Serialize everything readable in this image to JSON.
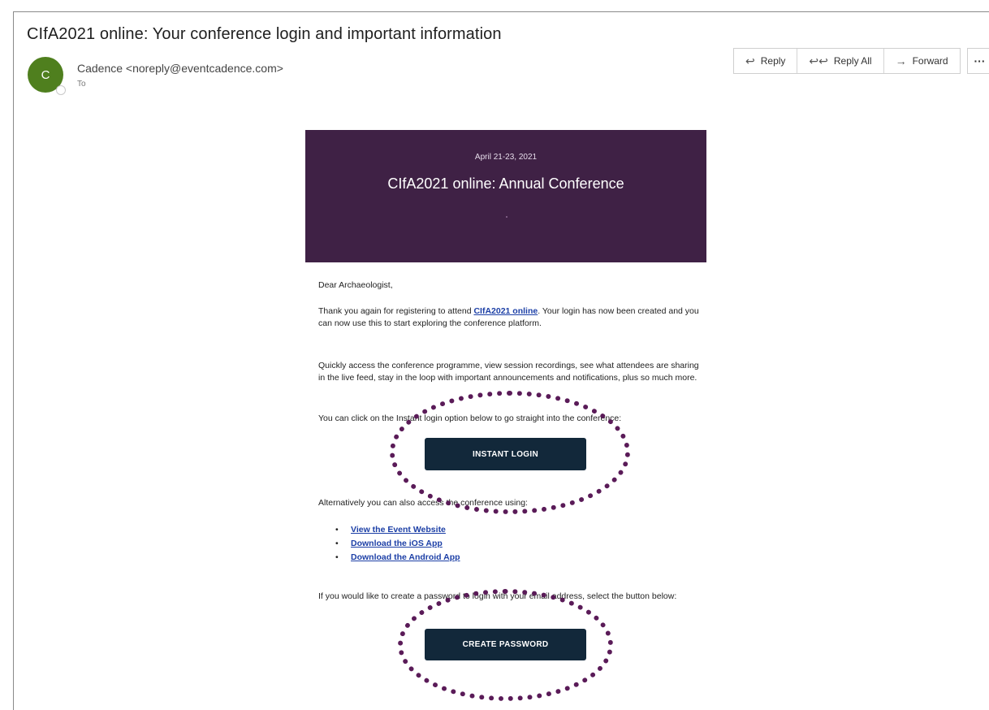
{
  "email": {
    "subject": "CIfA2021 online: Your conference login and important information",
    "sender": "Cadence <noreply@eventcadence.com>",
    "avatar_initial": "C",
    "to_label": "To"
  },
  "toolbar": {
    "reply_label": "Reply",
    "reply_all_label": "Reply All",
    "forward_label": "Forward",
    "more_label": "···"
  },
  "banner": {
    "date": "April 21-23, 2021",
    "title": "CIfA2021 online: Annual Conference",
    "background": "#3f2145"
  },
  "message": {
    "greeting": "Dear Archaeologist,",
    "para1_pre": "Thank you again for registering to attend ",
    "para1_link": "CIfA2021 online",
    "para1_post": ". Your login has now been created and you can now use this to start exploring the conference platform.",
    "para2": "Quickly access the conference programme, view session recordings, see what attendees are sharing in the live feed, stay in the loop with important announcements and notifications, plus so much more.",
    "para3": "You can click on the Instant login option below to go straight into the conference:",
    "instant_login_label": "INSTANT LOGIN",
    "para4": "Alternatively you can also access the conference using:",
    "links": [
      "View the Event Website",
      "Download the iOS App",
      "Download the Android App"
    ],
    "para5": "If you would like to create a password to login with your email address, select the button below:",
    "create_password_label": "CREATE PASSWORD"
  },
  "colors": {
    "avatar": "#4f7f1e",
    "button": "#12283a",
    "link": "#1c3fa6",
    "highlight_circle": "#5a1b58"
  }
}
